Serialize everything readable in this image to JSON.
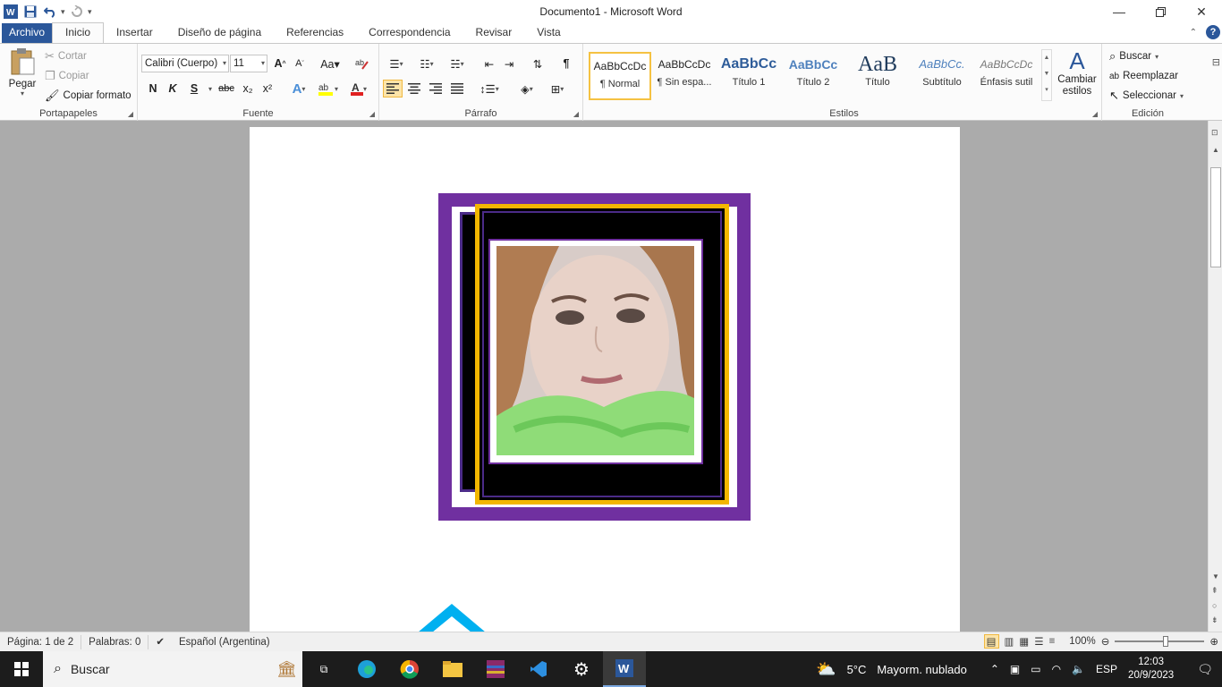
{
  "titlebar": {
    "title": "Documento1  -  Microsoft Word",
    "qat": [
      "word-logo-icon",
      "save-icon",
      "undo-icon",
      "redo-icon",
      "customize-qat-icon"
    ]
  },
  "tabs": {
    "file": "Archivo",
    "items": [
      "Inicio",
      "Insertar",
      "Diseño de página",
      "Referencias",
      "Correspondencia",
      "Revisar",
      "Vista"
    ],
    "active": "Inicio"
  },
  "ribbon": {
    "clipboard": {
      "label": "Portapapeles",
      "paste": "Pegar",
      "cut": "Cortar",
      "copy": "Copiar",
      "format_painter": "Copiar formato"
    },
    "font": {
      "label": "Fuente",
      "font_name": "Calibri (Cuerpo)",
      "font_size": "11",
      "bold": "N",
      "italic": "K",
      "underline": "S",
      "strike": "abc",
      "subscript": "x₂",
      "superscript": "x²"
    },
    "paragraph": {
      "label": "Párrafo"
    },
    "styles": {
      "label": "Estilos",
      "items": [
        {
          "sample": "AaBbCcDc",
          "name": "¶ Normal"
        },
        {
          "sample": "AaBbCcDc",
          "name": "¶ Sin espa..."
        },
        {
          "sample": "AaBbCc",
          "name": "Título 1"
        },
        {
          "sample": "AaBbCc",
          "name": "Título 2"
        },
        {
          "sample": "AaB",
          "name": "Título"
        },
        {
          "sample": "AaBbCc.",
          "name": "Subtítulo"
        },
        {
          "sample": "AaBbCcDc",
          "name": "Énfasis sutil"
        }
      ],
      "change_styles_1": "Cambiar",
      "change_styles_2": "estilos"
    },
    "editing": {
      "label": "Edición",
      "find": "Buscar",
      "replace": "Reemplazar",
      "select": "Seleccionar"
    }
  },
  "statusbar": {
    "page": "Página: 1 de 2",
    "words": "Palabras: 0",
    "language": "Español (Argentina)",
    "zoom": "100%"
  },
  "taskbar": {
    "search": "Buscar",
    "weather_temp": "5°C",
    "weather_desc": "Mayorm. nublado",
    "lang": "ESP",
    "time": "12:03",
    "date": "20/9/2023"
  },
  "colors": {
    "accent": "#2b579a",
    "frame_purple": "#7030a0",
    "frame_gold": "#f2b600",
    "shape_blue": "#00b0f0"
  }
}
